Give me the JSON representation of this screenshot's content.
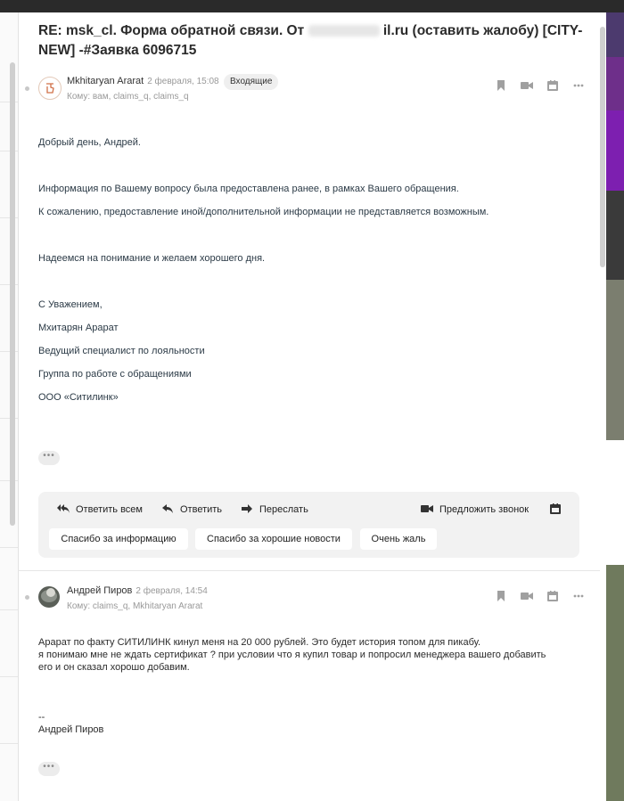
{
  "subject": {
    "line1": "RE: msk_cl. Форма обратной связи. От",
    "line1_tail": "il.ru (оставить жалобу) [CITY-",
    "line2": "NEW] -#Заявка 6096715"
  },
  "messages": [
    {
      "sender": "Mkhitaryan Ararat",
      "time": "2 февраля, 15:08",
      "badge": "Входящие",
      "to": "Кому: вам, claims_q, claims_q",
      "body": [
        "Добрый день, Андрей.",
        "Информация по Вашему вопросу была предоставлена ранее, в рамках Вашего обращения.",
        "К сожалению, предоставление иной/дополнительной информации не представляется возможным.",
        "Надеемся на понимание и желаем хорошего дня.",
        "С Уважением,",
        "Мхитарян Арарат",
        "Ведущий специалист по лояльности",
        "Группа по работе с обращениями",
        "ООО «Ситилинк»"
      ]
    },
    {
      "sender": "Андрей Пиров",
      "time": "2 февраля, 14:54",
      "to": "Кому: claims_q, Mkhitaryan Ararat",
      "body": [
        "Арарат по факту СИТИЛИНК кинул меня на 20 000 рублей.  Это будет история топом для пикабу.",
        "я понимаю мне не ждать сертификат ? при условии что я купил товар и попросил менеджера вашего добавить",
        "его и он сказал хорошо добавим.",
        "--",
        "Андрей Пиров"
      ]
    }
  ],
  "reply_actions": {
    "reply_all": "Ответить всем",
    "reply": "Ответить",
    "forward": "Переслать",
    "propose_call": "Предложить звонок"
  },
  "quick_replies": [
    "Спасибо за информацию",
    "Спасибо за хорошие новости",
    "Очень жаль"
  ],
  "more_label": "•••",
  "icons": {
    "bookmark": "bookmark-icon",
    "video": "video-call-icon",
    "calendar": "calendar-icon",
    "more": "more-dots-icon"
  },
  "colors": {
    "body_text": "#2b3a46",
    "muted": "#999999",
    "panel": "#f2f2f2"
  }
}
